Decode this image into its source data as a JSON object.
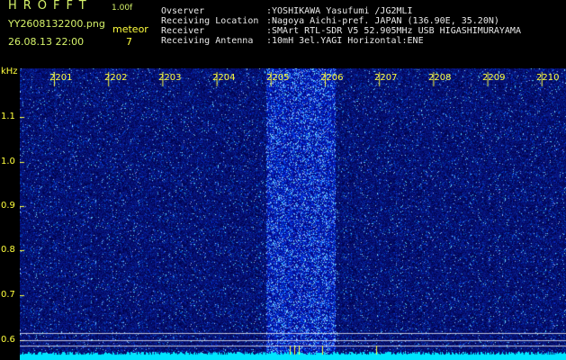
{
  "app": {
    "title": "HROFFT",
    "version": "1.00f",
    "file_name": "YY2608132200.png",
    "timestamp": "26.08.13 22:00",
    "meteor_label": "meteor",
    "meteor_count": "7"
  },
  "info": {
    "rows": [
      {
        "label": "Ovserver",
        "value": ":YOSHIKAWA Yasufumi /JG2MLI"
      },
      {
        "label": "Receiving Location",
        "value": ":Nagoya Aichi-pref. JAPAN (136.90E, 35.20N)"
      },
      {
        "label": "Receiver",
        "value": ":SMArt RTL-SDR V5 52.905MHz USB HIGASHIMURAYAMA"
      },
      {
        "label": "Receiving Antenna",
        "value": ":10mH 3el.YAGI Horizontal:ENE"
      }
    ]
  },
  "axes": {
    "y_unit": "kHz",
    "y_ticks": [
      "1.1",
      "1.0",
      "0.9",
      "0.8",
      "0.7",
      "0.6"
    ],
    "x_ticks": [
      "2201",
      "2202",
      "2203",
      "2204",
      "2205",
      "2206",
      "2207",
      "2208",
      "2209",
      "2210"
    ]
  },
  "colors": {
    "background": "#000000",
    "grid": "#ffff3d",
    "noise_base": "#0a1a9e",
    "noise_bright": "#9ad8ff",
    "baseline": "#00e5ff",
    "marker_lines": "#ffffff"
  },
  "spectrogram": {
    "freq_range_khz": [
      0.58,
      1.15
    ],
    "time_range": [
      "2200",
      "2210"
    ],
    "hot_band_minutes": [
      2205,
      2206
    ],
    "baseline_label": ""
  }
}
